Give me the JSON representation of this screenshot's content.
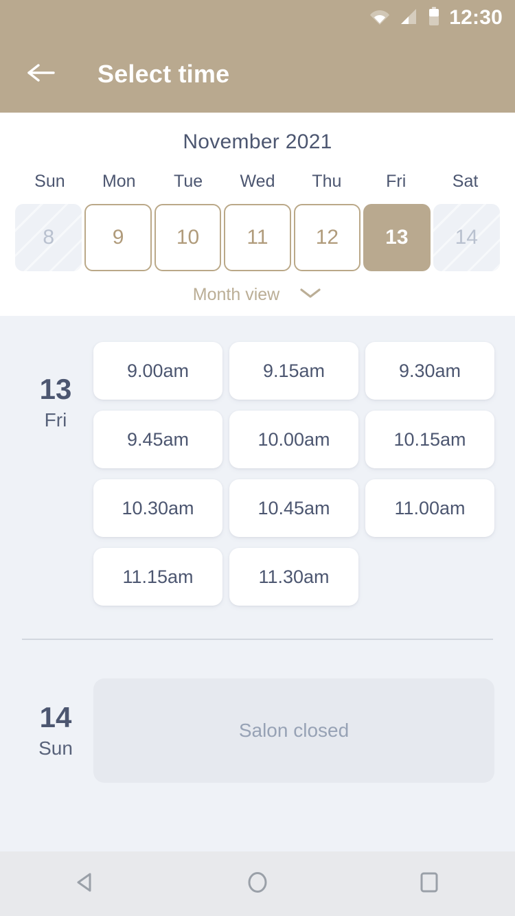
{
  "statusbar": {
    "time": "12:30",
    "icons": [
      "wifi-icon",
      "cellular-signal-icon",
      "battery-icon"
    ]
  },
  "appbar": {
    "back_icon": "back-arrow-icon",
    "title": "Select time"
  },
  "calendar": {
    "month_title": "November 2021",
    "day_headers": [
      "Sun",
      "Mon",
      "Tue",
      "Wed",
      "Thu",
      "Fri",
      "Sat"
    ],
    "days": [
      {
        "number": "8",
        "state": "disabled"
      },
      {
        "number": "9",
        "state": "available"
      },
      {
        "number": "10",
        "state": "available"
      },
      {
        "number": "11",
        "state": "available"
      },
      {
        "number": "12",
        "state": "available"
      },
      {
        "number": "13",
        "state": "selected"
      },
      {
        "number": "14",
        "state": "disabled"
      }
    ],
    "view_toggle_label": "Month view",
    "view_toggle_icon": "chevron-down-icon"
  },
  "schedule": [
    {
      "day_number": "13",
      "day_name": "Fri",
      "slots": [
        "9.00am",
        "9.15am",
        "9.30am",
        "9.45am",
        "10.00am",
        "10.15am",
        "10.30am",
        "10.45am",
        "11.00am",
        "11.15am",
        "11.30am"
      ],
      "closed_message": null
    },
    {
      "day_number": "14",
      "day_name": "Sun",
      "slots": [],
      "closed_message": "Salon closed"
    }
  ],
  "navbar": {
    "back_label": "back-nav-icon",
    "home_label": "home-nav-icon",
    "recents_label": "recents-nav-icon"
  },
  "colors": {
    "brand_tan": "#b9a98f",
    "day_border_tan": "#baa888",
    "content_bg": "#eff2f7",
    "text_slate": "#4c5670",
    "navbar_bg": "#e8e9ec"
  }
}
